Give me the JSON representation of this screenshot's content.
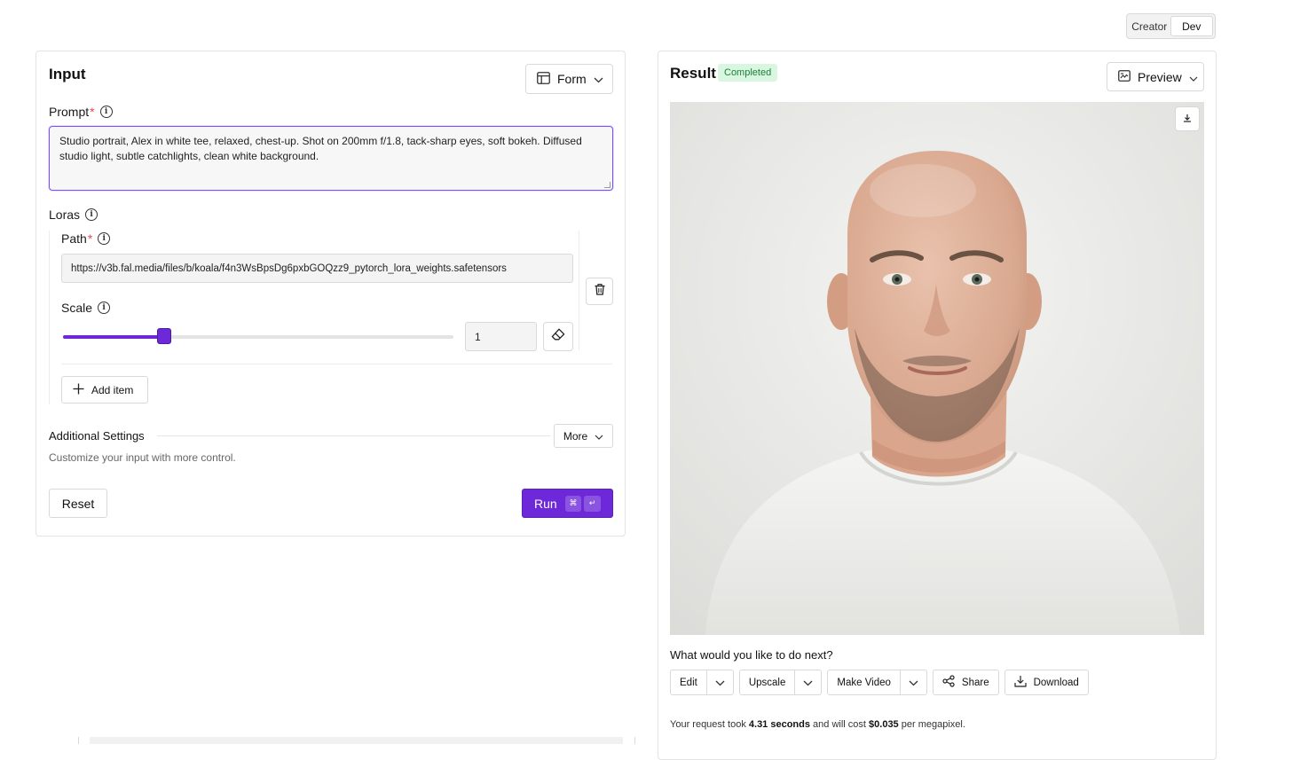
{
  "mode_toggle": {
    "options": [
      "Creator",
      "Dev"
    ],
    "active": "Dev"
  },
  "input": {
    "title": "Input",
    "view_dropdown": {
      "label": "Form",
      "icon": "table-layout-icon"
    },
    "prompt": {
      "label": "Prompt",
      "required_mark": "*",
      "value": "Studio portrait, Alex in white tee, relaxed, chest-up. Shot on 200mm f/1.8, tack-sharp eyes, soft bokeh. Diffused studio light, subtle catchlights, clean white background."
    },
    "loras": {
      "label": "Loras",
      "items": [
        {
          "path_label": "Path",
          "path_required_mark": "*",
          "path_value": "https://v3b.fal.media/files/b/koala/f4n3WsBpsDg6pxbGOQzz9_pytorch_lora_weights.safetensors",
          "scale_label": "Scale",
          "scale_value": "1",
          "slider_fraction": 0.26
        }
      ],
      "add_item_label": "Add item"
    },
    "additional_settings": {
      "title": "Additional Settings",
      "subtitle": "Customize your input with more control.",
      "more_label": "More"
    },
    "reset_label": "Reset",
    "run": {
      "label": "Run",
      "shortcut_keys": [
        "⌘",
        "↵"
      ]
    }
  },
  "result": {
    "title": "Result",
    "status": "Completed",
    "view_dropdown": {
      "label": "Preview",
      "icon": "image-preview-icon"
    },
    "next_question": "What would you like to do next?",
    "actions": {
      "edit": "Edit",
      "upscale": "Upscale",
      "make_video": "Make Video",
      "share": "Share",
      "download": "Download"
    },
    "cost": {
      "prefix": "Your request took",
      "duration": "4.31 seconds",
      "middle": "and will cost",
      "price": "$0.035",
      "suffix": "per megapixel."
    }
  },
  "colors": {
    "accent": "#6d28d9",
    "status_bg": "#d9f7e0",
    "status_text": "#1a7f37",
    "required": "#e5484d"
  }
}
